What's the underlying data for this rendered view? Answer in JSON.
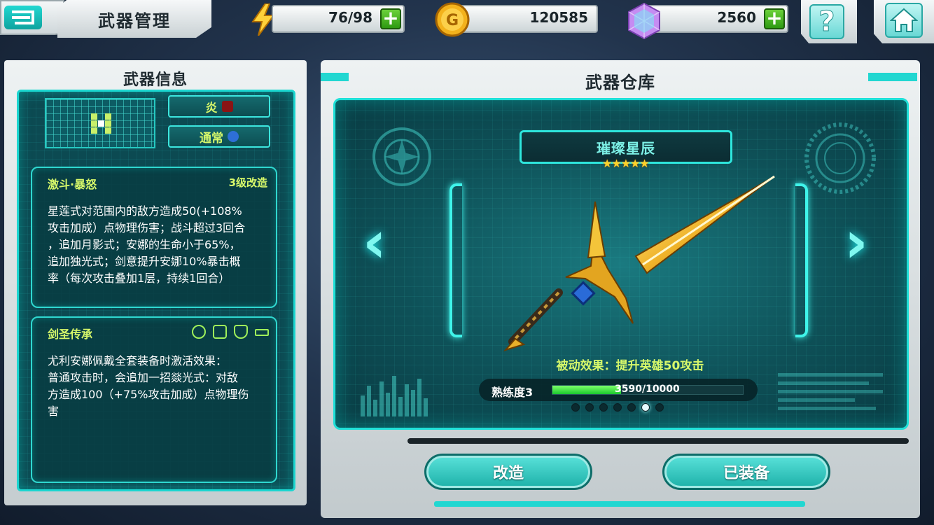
{
  "header": {
    "title": "武器管理",
    "energy": "76/98",
    "coins": "120585",
    "gems": "2560",
    "help_symbol": "?"
  },
  "left_panel": {
    "title": "武器信息",
    "element_tag": "炎",
    "type_tag": "通常",
    "skill": {
      "name": "激斗·暴怒",
      "level": "3级改造",
      "lines": [
        "星莲式对范围内的敌方造成50(+108%",
        "攻击加成）点物理伤害；战斗超过3回合",
        "，追加月影式；安娜的生命小于65%，",
        "追加独光式；剑意提升安娜10%暴击概",
        "率（每次攻击叠加1层，持续1回合）"
      ]
    },
    "set": {
      "name": "剑圣传承",
      "lines": [
        "尤利安娜佩戴全套装备时激活效果：",
        "普通攻击时，会追加一招燚光式：对敌",
        "方造成100（+75%攻击加成）点物理伤",
        "害"
      ]
    }
  },
  "right_panel": {
    "title": "武器仓库",
    "weapon_name": "璀璨星辰",
    "stars": "★★★★★",
    "star_count": 5,
    "passive": "被动效果：提升英雄50攻击",
    "proficiency_label": "熟练度3",
    "proficiency_progress": "3590/10000",
    "proficiency_fraction": 0.359,
    "page_count": 7,
    "page_active": 6,
    "prev_arrow": "‹",
    "next_arrow": "›",
    "btn_upgrade": "改造",
    "btn_equipped": "已装备"
  },
  "colors": {
    "accent": "#1fe0d8",
    "highlight": "#d7f86a",
    "star": "#ffd12a"
  },
  "icons": [
    "back-icon",
    "lightning-icon",
    "coin-icon",
    "gem-icon",
    "help-icon",
    "home-icon",
    "fire-element-icon",
    "normal-type-icon",
    "helmet-icon",
    "armor-icon",
    "shield-icon",
    "gun-icon",
    "sword-image"
  ]
}
